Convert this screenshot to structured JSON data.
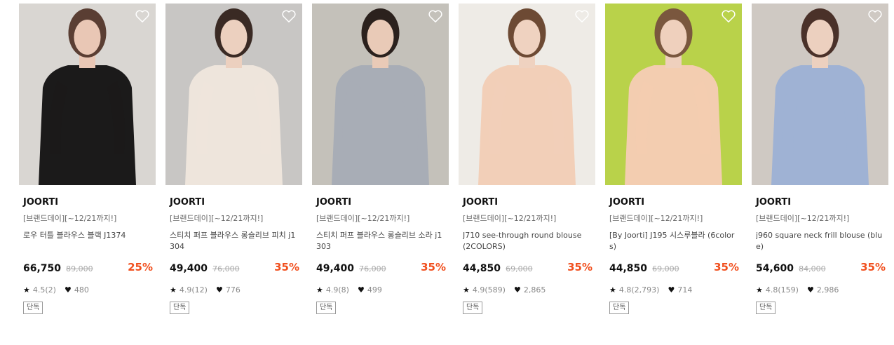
{
  "products": [
    {
      "brand": "JOORTI",
      "promo": "[브랜드데이][~12/21까지!]",
      "title": "로우 터틀 블라우스 블랙 J1374",
      "price": "66,750",
      "original_price": "89,000",
      "discount": "25%",
      "rating": "4.5(2)",
      "likes": "480",
      "badge": "단독",
      "wish_icon": "heart-outline-icon",
      "colors": {
        "bg": "#d9d6d2",
        "top": "#1b1a1a",
        "bottom": "#ddd6ce",
        "skin": "#e9c7b5",
        "hair": "#5a3e33"
      }
    },
    {
      "brand": "JOORTI",
      "promo": "[브랜드데이][~12/21까지!]",
      "title": "스티치 퍼프 블라우스 롱슬리브 피치 j1304",
      "price": "49,400",
      "original_price": "76,000",
      "discount": "35%",
      "rating": "4.9(12)",
      "likes": "776",
      "badge": "단독",
      "wish_icon": "heart-outline-icon",
      "colors": {
        "bg": "#c8c6c4",
        "top": "#eee5dc",
        "bottom": "#5d4a40",
        "skin": "#ecd0bf",
        "hair": "#3a2a24"
      }
    },
    {
      "brand": "JOORTI",
      "promo": "[브랜드데이][~12/21까지!]",
      "title": "스티치 퍼프 블라우스 롱슬리브 소라 j1303",
      "price": "49,400",
      "original_price": "76,000",
      "discount": "35%",
      "rating": "4.9(8)",
      "likes": "499",
      "badge": "단독",
      "wish_icon": "heart-outline-icon",
      "colors": {
        "bg": "#c4c1ba",
        "top": "#a8adb6",
        "bottom": "#efefea",
        "skin": "#e9cab7",
        "hair": "#2b211d"
      }
    },
    {
      "brand": "JOORTI",
      "promo": "[브랜드데이][~12/21까지!]",
      "title": "J710 see-through round blouse (2COLORS)",
      "price": "44,850",
      "original_price": "69,000",
      "discount": "35%",
      "rating": "4.9(589)",
      "likes": "2,865",
      "badge": "단독",
      "wish_icon": "heart-outline-icon",
      "colors": {
        "bg": "#eeebe6",
        "top": "#f2cfb8",
        "bottom": "#141414",
        "skin": "#efd2c0",
        "hair": "#6d4a34"
      }
    },
    {
      "brand": "JOORTI",
      "promo": "[브랜드데이][~12/21까지!]",
      "title": "[By Joorti] J195 시스루블라 (6colors)",
      "price": "44,850",
      "original_price": "69,000",
      "discount": "35%",
      "rating": "4.8(2,793)",
      "likes": "714",
      "badge": "단독",
      "wish_icon": "heart-outline-icon",
      "colors": {
        "bg": "#b9d24a",
        "top": "#f3cdb0",
        "bottom": "#1c1c1c",
        "skin": "#efd0bd",
        "hair": "#7a573e"
      }
    },
    {
      "brand": "JOORTI",
      "promo": "[브랜드데이][~12/21까지!]",
      "title": "j960 square neck frill blouse (blue)",
      "price": "54,600",
      "original_price": "84,000",
      "discount": "35%",
      "rating": "4.8(159)",
      "likes": "2,986",
      "badge": "단독",
      "wish_icon": "heart-outline-icon",
      "colors": {
        "bg": "#cfc9c3",
        "top": "#9fb2d4",
        "bottom": "#c9c2bb",
        "skin": "#ecd0bf",
        "hair": "#4a3129"
      }
    }
  ]
}
